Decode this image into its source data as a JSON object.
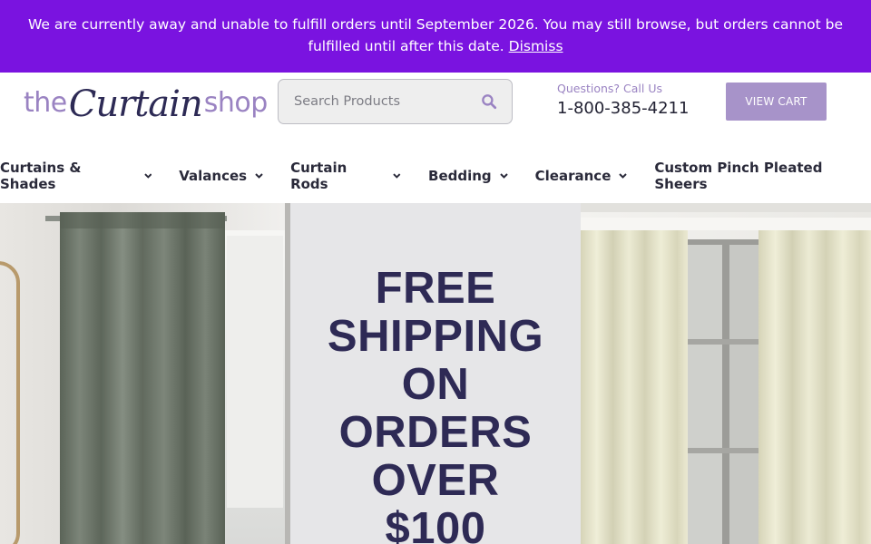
{
  "notice": {
    "text": "We are currently away and unable to fulfill orders until September 2026. You may still browse, but orders cannot be fulfilled until after this date.",
    "dismiss_label": "Dismiss",
    "background": "#7a13e0"
  },
  "header": {
    "logo": {
      "the": "the",
      "curtain": "Curtain",
      "shop": "shop"
    },
    "search": {
      "placeholder": "Search Products",
      "value": "",
      "icon": "search-icon"
    },
    "contact": {
      "label": "Questions? Call Us",
      "phone": "1-800-385-4211"
    },
    "cart_label": "VIEW CART",
    "brand_color": "#9a83c2",
    "cart_color": "#a793c9"
  },
  "nav": {
    "items": [
      {
        "label": "Curtains & Shades",
        "has_dropdown": true
      },
      {
        "label": "Valances",
        "has_dropdown": true
      },
      {
        "label": "Curtain Rods",
        "has_dropdown": true
      },
      {
        "label": "Bedding",
        "has_dropdown": true
      },
      {
        "label": "Clearance",
        "has_dropdown": true
      },
      {
        "label": "Custom Pinch Pleated Sheers",
        "has_dropdown": false
      }
    ]
  },
  "hero": {
    "promo_lines": [
      "FREE",
      "SHIPPING",
      "ON",
      "ORDERS",
      "OVER",
      "$100"
    ],
    "promo_color": "#2e2a55",
    "left_image": "grey-green velvet curtain panel",
    "right_image": "ivory curtain panels by window"
  }
}
